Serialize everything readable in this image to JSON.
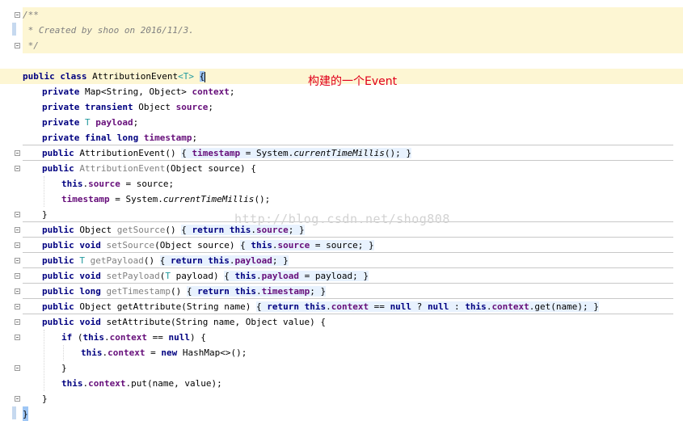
{
  "code": {
    "comment_open": "/**",
    "comment_body": " * Created by shoo on 2016/11/3.",
    "comment_close": " */",
    "class_public": "public",
    "class_kw": "class",
    "class_name": "AttributionEvent",
    "type_param": "<T>",
    "open_brace": "{",
    "close_brace": "}",
    "f1_type": "Map<String, Object>",
    "f1_name": "context",
    "f2_type": "Object",
    "f2_name": "source",
    "f3_type": "T",
    "f3_name": "payload",
    "f4_name": "timestamp",
    "kw_private": "private",
    "kw_transient": "transient",
    "kw_final": "final",
    "kw_long": "long",
    "kw_public": "public",
    "kw_void": "void",
    "kw_this": "this",
    "kw_return": "return",
    "kw_null": "null",
    "kw_if": "if",
    "kw_new": "new",
    "ctor1_sig": "AttributionEvent()",
    "ctor2_name": "AttributionEvent",
    "ctor2_params": "(Object source) {",
    "system_prefix": " = System.",
    "millis": "currentTimeMillis",
    "millis_suffix": "();",
    "assign_source": " = source;",
    "m1_ret": "Object",
    "m1_name": "getSource",
    "m2_name": "setSource",
    "m2_params": "(Object source)",
    "m3_name": "getPayload",
    "m4_name": "setPayload",
    "m4_params_a": "(",
    "m4_params_b": " payload)",
    "m4_assign": " = payload;",
    "m5_name": "getTimestamp",
    "m6_name": "getAttribute",
    "m6_params": "(String name)",
    "m6_cmp": " == ",
    "m6_q": " ? ",
    "m6_colon": " : ",
    "m6_get": ".get(name);",
    "m7_name": "setAttribute",
    "m7_params": "(String name, Object value) {",
    "if_cond_close": ") {",
    "new_map": " HashMap<>();",
    "put_call": ".put(name, value);"
  },
  "annotation": "构建的一个Event",
  "watermark": "http://blog.csdn.net/shog808"
}
